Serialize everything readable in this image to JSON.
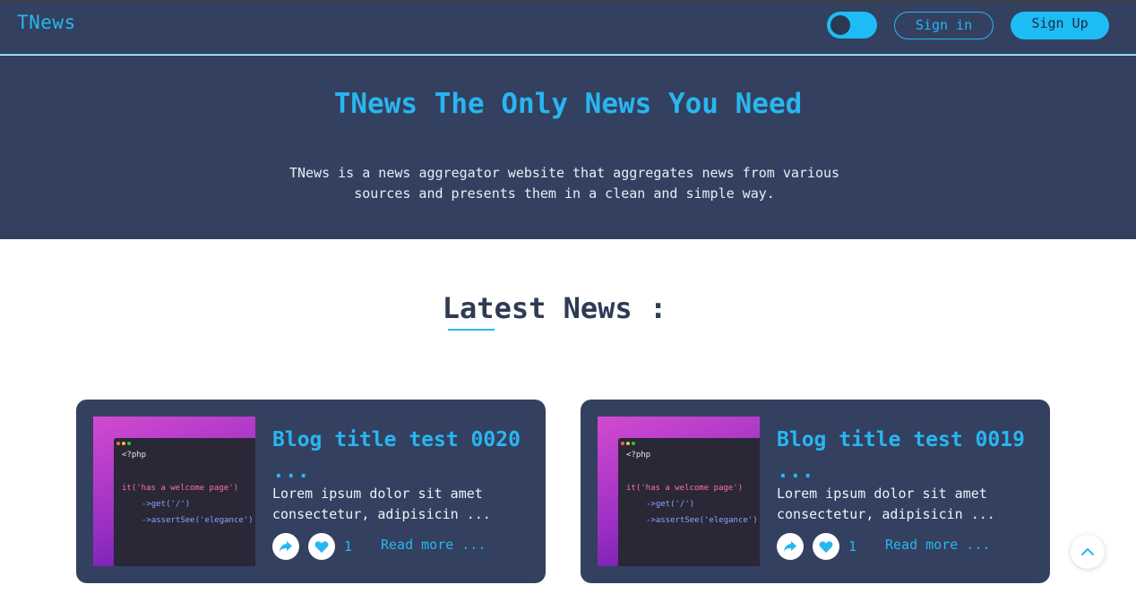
{
  "header": {
    "brand": "TNews",
    "signin_label": "Sign in",
    "signup_label": "Sign Up",
    "theme_toggle_icon": "toggle-switch"
  },
  "hero": {
    "title": "TNews The Only News You Need",
    "description": "TNews is a news aggregator website that aggregates news from various sources and presents them in a clean and simple way."
  },
  "latest": {
    "heading": "Latest News :"
  },
  "cards": [
    {
      "title": "Blog title test 0020 ...",
      "excerpt": "Lorem ipsum dolor sit amet consectetur, adipisicin ...",
      "likes": "1",
      "read_more": "Read more ...",
      "code_lines": [
        "<?php",
        "it('has a welcome page')",
        "->get('/')",
        "->assertSee('elegance')"
      ]
    },
    {
      "title": "Blog title test 0019 ...",
      "excerpt": "Lorem ipsum dolor sit amet consectetur, adipisicin ...",
      "likes": "1",
      "read_more": "Read more ...",
      "code_lines": [
        "<?php",
        "it('has a welcome page')",
        "->get('/')",
        "->assertSee('elegance')"
      ]
    }
  ],
  "colors": {
    "nav_bg": "#334060",
    "accent": "#28b6f0",
    "heading_dark": "#2f3b55",
    "page_bg": "#ffffff"
  },
  "icons": {
    "share": "share-icon",
    "like": "heart-icon",
    "scroll_top": "chevron-up-icon"
  }
}
